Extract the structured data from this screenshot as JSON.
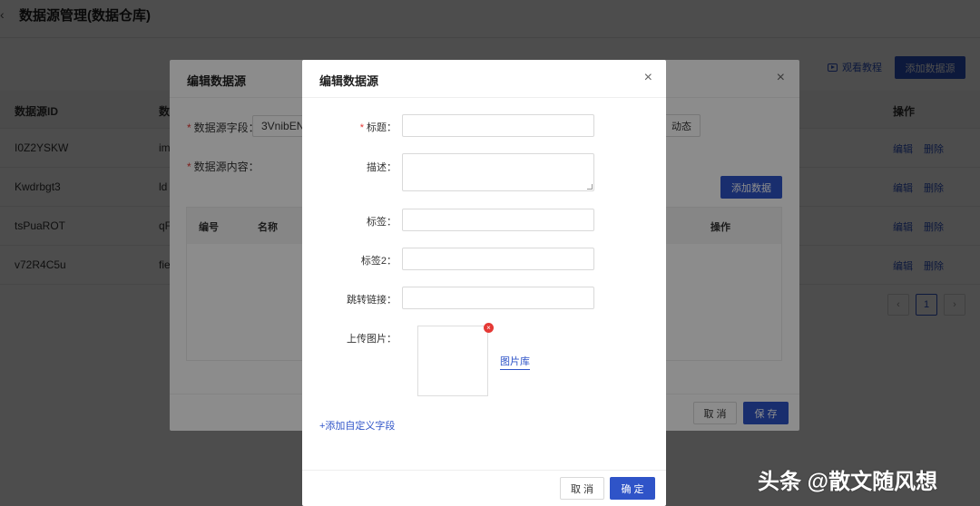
{
  "page": {
    "back_icon": "‹",
    "title": "数据源管理(数据仓库)",
    "tutorial_label": "观看教程",
    "add_source_label": "添加数据源"
  },
  "table": {
    "headers": {
      "id": "数据源ID",
      "name": "数",
      "op": "操作"
    },
    "rows": [
      {
        "id": "I0Z2YSKW",
        "name": "im"
      },
      {
        "id": "Kwdrbgt3",
        "name": "ld"
      },
      {
        "id": "tsPuaROT",
        "name": "qF"
      },
      {
        "id": "v72R4C5u",
        "name": "fie"
      }
    ],
    "edit_label": "编辑",
    "delete_label": "删除"
  },
  "pager": {
    "prev": "‹",
    "current": "1",
    "next": "›"
  },
  "modal1": {
    "title": "编辑数据源",
    "close": "×",
    "field_label": "数据源字段：",
    "field_value": "3VnibEN",
    "content_label": "数据源内容：",
    "dynamic_label": "动态",
    "add_data_label": "添加数据",
    "col_no": "编号",
    "col_name": "名称",
    "col_op": "操作",
    "cancel_label": "取 消",
    "save_label": "保 存"
  },
  "modal2": {
    "title": "编辑数据源",
    "close": "×",
    "title_label": "标题：",
    "desc_label": "描述：",
    "tag_label": "标签：",
    "tag2_label": "标签2：",
    "link_label": "跳转链接：",
    "upload_label": "上传图片：",
    "remove_icon": "×",
    "gallery_label": "图片库",
    "add_custom_label": "+添加自定义字段",
    "cancel_label": "取 消",
    "ok_label": "确 定"
  },
  "watermark": "头条 @散文随风想"
}
